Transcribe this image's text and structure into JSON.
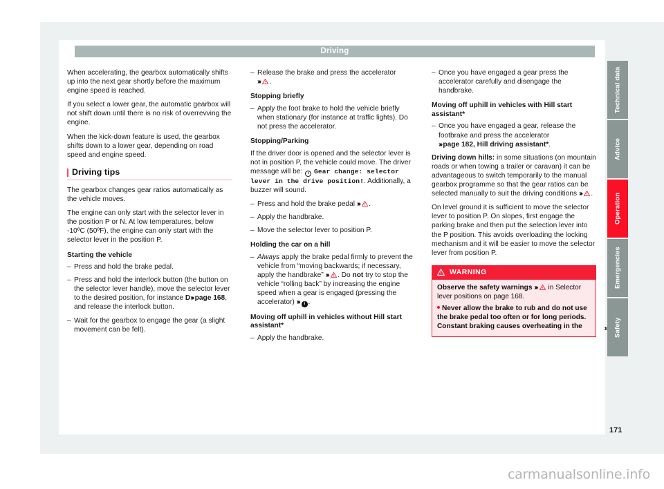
{
  "header": {
    "title": "Driving"
  },
  "page": {
    "number": "171",
    "watermark": "carmanualsonline.info",
    "continuation_marker": "»"
  },
  "sidebar": {
    "tabs": [
      {
        "label": "Technical data",
        "active": false,
        "height": 84
      },
      {
        "label": "Advice",
        "active": false,
        "height": 84
      },
      {
        "label": "Operation",
        "active": true,
        "height": 84
      },
      {
        "label": "Emergencies",
        "active": false,
        "height": 84
      },
      {
        "label": "Safety",
        "active": false,
        "height": 84
      }
    ],
    "accent_active": "#fa1126",
    "accent_inactive": "#8b9795"
  },
  "column1": {
    "p1": "When accelerating, the gearbox automatically shifts up into the next gear shortly before the maximum engine speed is reached.",
    "p2": "If you select a lower gear, the automatic gearbox will not shift down until there is no risk of overrevving the engine.",
    "p3": "When the kick-down feature is used, the gearbox shifts down to a lower gear, depending on road speed and engine speed.",
    "section_title": "Driving tips",
    "p4": "The gearbox changes gear ratios automatically as the vehicle moves.",
    "p5": "The engine can only start with the selector lever in the position P or N. At low temperatures, below -10ºC (50ºF), the engine can only start with the selector lever in the position P.",
    "h_starting": "Starting the vehicle",
    "item1": "Press and hold the brake pedal.",
    "item2_a": "Press and hold the interlock button (the button on the selector lever handle), move the selector lever to the desired position, for instance ",
    "item2_bold_d": "D",
    "item2_ref": "page 168",
    "item2_b": ", and release the interlock button.",
    "item3": "Wait for the gearbox to engage the gear (a slight movement can be felt)."
  },
  "column2": {
    "item_release": "Release the brake and press the accelerator",
    "h_stopping_briefly": "Stopping briefly",
    "item_footbrake": "Apply the foot brake to hold the vehicle briefly when stationary (for instance at traffic lights). Do not press the accelerator.",
    "h_stopping_parking": "Stopping/Parking",
    "p_door_a": "If the driver door is opened and the selector lever is not in position P, the vehicle could move. The driver message will be:",
    "mono_msg": "Gear change: selector lever in the drive position!",
    "p_door_b": ". Additionally, a buzzer will sound.",
    "item_brake_hold": "Press and hold the brake pedal",
    "item_handbrake": "Apply the handbrake.",
    "item_move_p": "Move the selector lever to position P.",
    "h_holding_hill": "Holding the car on a hill",
    "item_hill_always": "Always",
    "item_hill_a": " apply the brake pedal firmly to prevent the vehicle from “moving backwards; if necessary, apply the handbrake” ",
    "item_hill_b": ". Do ",
    "item_hill_not": "not",
    "item_hill_c": " try to stop the vehicle “rolling back” by increasing the engine speed when a gear is engaged (pressing the accelerator) ",
    "h_moving_uphill_without": "Moving off uphill in vehicles without Hill start assistant*",
    "item_apply_handbrake": "Apply the handbrake."
  },
  "column3": {
    "item_engaged_gear": "Once you have engaged a gear press the accelerator carefully and disengage the handbrake.",
    "h_moving_uphill_with": "Moving off uphill in vehicles with Hill start assistant*",
    "item_release_footbrake": "Once you have engaged a gear, release the footbrake and press the accelerator",
    "item_release_ref": "page 182, Hill driving assistant*",
    "p_downhill_label": "Driving down hills:",
    "p_downhill_text": " in some situations (on mountain roads or when towing a trailer or caravan) it can be advantageous to switch temporarily to the manual gearbox programme so that the gear ratios can be selected manually to suit the driving conditions ",
    "p_level_ground": "On level ground it is sufficient to move the selector lever to position P. On slopes, first engage the parking brake and then put the selection lever into the P position. This avoids overloading the locking mechanism and it will be easier to move the selector lever from position P.",
    "warning": {
      "title": "WARNING",
      "line1_a": "Observe the safety warnings ",
      "line1_b": " in Selector lever positions on page 168.",
      "line2": "Never allow the brake to rub and do not use the brake pedal too often or for long periods. Constant braking causes overheating in the"
    }
  },
  "icons": {
    "chevron": "»›",
    "warning_triangle": "warning-triangle-icon",
    "info_circle": "info-circle-icon"
  }
}
